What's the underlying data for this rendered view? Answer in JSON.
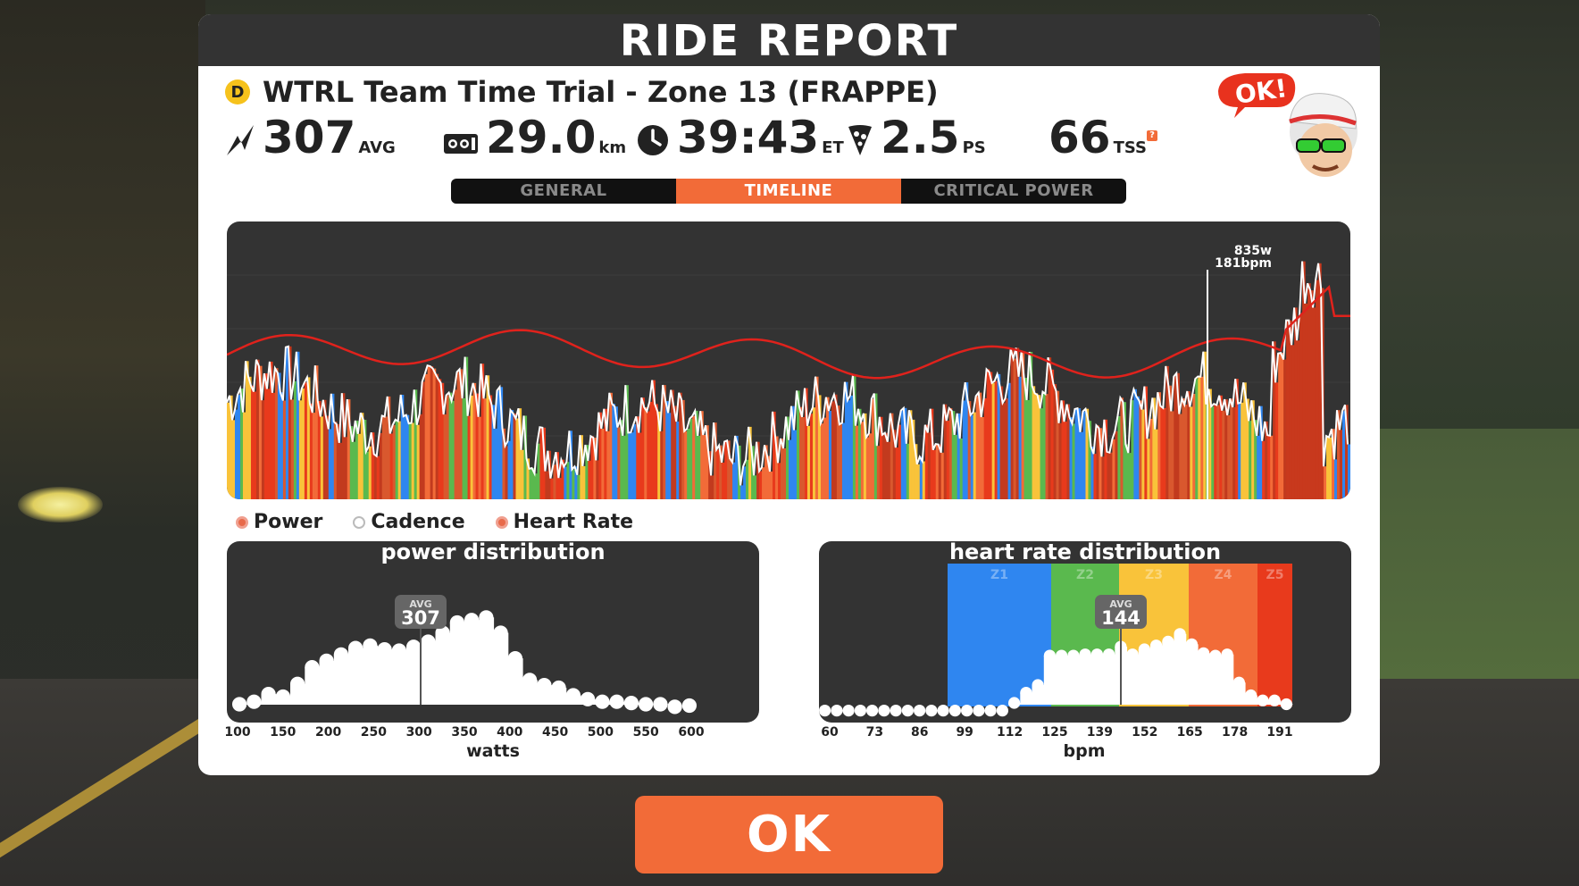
{
  "window_title": "RIDE REPORT",
  "route": {
    "badge": "D",
    "name": "WTRL Team Time Trial - Zone 13 (FRAPPE)"
  },
  "stats": {
    "power": {
      "value": "307",
      "unit": "AVG"
    },
    "distance": {
      "value": "29.0",
      "unit": "km"
    },
    "time": {
      "value": "39:43",
      "unit": "ET"
    },
    "pizza": {
      "value": "2.5",
      "unit": "PS"
    },
    "tss": {
      "value": "66",
      "unit": "TSS"
    }
  },
  "mascot_speech": "OK!",
  "tabs": [
    {
      "label": "GENERAL",
      "active": false
    },
    {
      "label": "TIMELINE",
      "active": true
    },
    {
      "label": "CRITICAL POWER",
      "active": false
    }
  ],
  "timeline": {
    "peak_power_label": "835w",
    "peak_hr_label": "181bpm"
  },
  "legend": [
    {
      "label": "Power",
      "selected": true
    },
    {
      "label": "Cadence",
      "selected": false
    },
    {
      "label": "Heart Rate",
      "selected": true
    }
  ],
  "power_distribution": {
    "title": "power distribution",
    "avg_label": "AVG",
    "avg_value": "307",
    "x_ticks": [
      "100",
      "150",
      "200",
      "250",
      "300",
      "350",
      "400",
      "450",
      "500",
      "550",
      "600"
    ],
    "x_label": "watts"
  },
  "hr_distribution": {
    "title": "heart rate distribution",
    "avg_label": "AVG",
    "avg_value": "144",
    "zones": [
      "Z1",
      "Z2",
      "Z3",
      "Z4",
      "Z5"
    ],
    "x_ticks": [
      "60",
      "73",
      "86",
      "99",
      "112",
      "125",
      "139",
      "152",
      "165",
      "178",
      "191"
    ],
    "x_label": "bpm"
  },
  "ok_button": "OK",
  "colors": {
    "accent": "#f26b38",
    "panel_dark": "#333333",
    "z1": "#2f86f0",
    "z2": "#5ab94e",
    "z3": "#f9c33a",
    "z4": "#f26b38",
    "z5": "#e83a1c"
  }
}
